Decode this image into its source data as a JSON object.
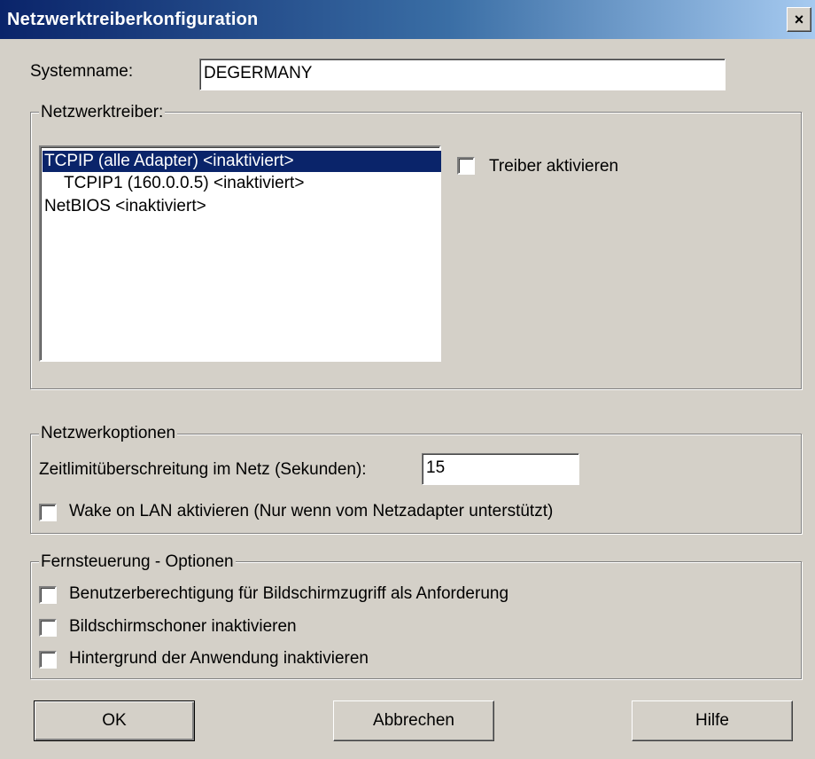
{
  "window": {
    "title": "Netzwerktreiberkonfiguration",
    "close_glyph": "×",
    "close_icon": "close-icon"
  },
  "system": {
    "label": "Systemname:",
    "value": "DEGERMANY"
  },
  "drivers": {
    "legend": "Netzwerktreiber:",
    "items": [
      {
        "label": "TCPIP (alle Adapter) <inaktiviert>",
        "selected": true,
        "indent": 0
      },
      {
        "label": "TCPIP1 (160.0.0.5) <inaktiviert>",
        "selected": false,
        "indent": 1
      },
      {
        "label": "NetBIOS <inaktiviert>",
        "selected": false,
        "indent": 0
      }
    ],
    "enable_label": "Treiber aktivieren",
    "enable_checked": false
  },
  "network_options": {
    "legend": "Netzwerkoptionen",
    "timeout_label": "Zeitlimitüberschreitung im Netz (Sekunden):",
    "timeout_value": "15",
    "wol_label": "Wake on LAN aktivieren (Nur wenn vom Netzadapter unterstützt)",
    "wol_checked": false
  },
  "remote_options": {
    "legend": "Fernsteuerung - Optionen",
    "items": [
      {
        "label": "Benutzerberechtigung für Bildschirmzugriff als Anforderung",
        "checked": false
      },
      {
        "label": "Bildschirmschoner inaktivieren",
        "checked": false
      },
      {
        "label": "Hintergrund der Anwendung inaktivieren",
        "checked": false
      }
    ]
  },
  "buttons": {
    "ok": "OK",
    "cancel": "Abbrechen",
    "help": "Hilfe"
  }
}
